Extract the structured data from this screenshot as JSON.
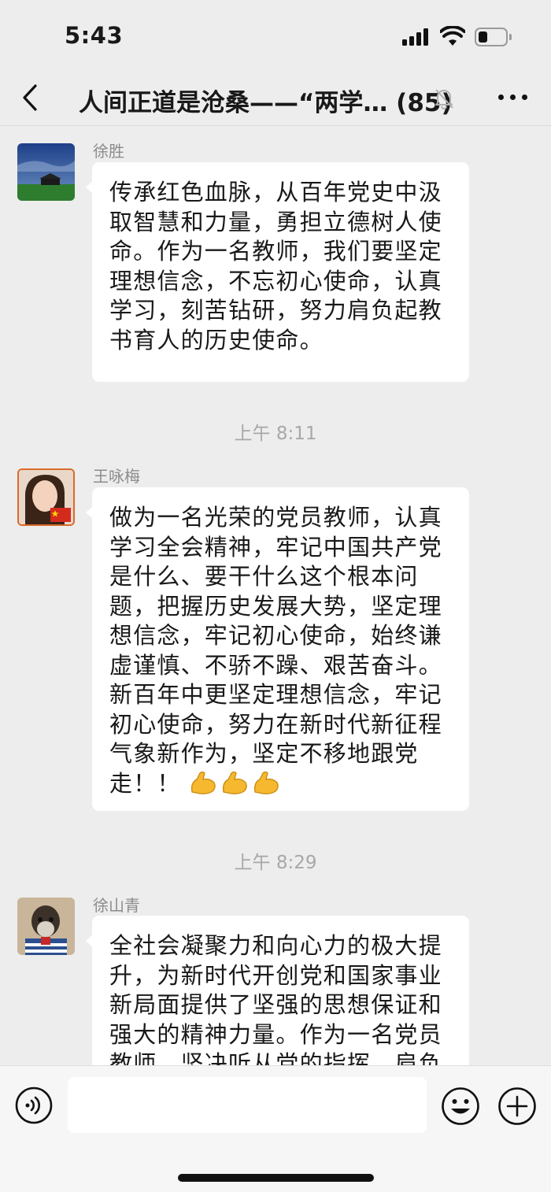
{
  "status_bar": {
    "time": "5:43",
    "battery_level": 0.35
  },
  "header": {
    "title": "人间正道是沧桑——“两学… (85)",
    "member_count": "85",
    "muted": true
  },
  "messages": [
    {
      "sender": "徐胜",
      "avatar_icon": "landscape-avatar-icon",
      "text": "传承红色血脉，从百年党史中汲\n取智慧和力量，勇担立德树人使\n命。作为一名教师，我们要坚定\n理想信念，不忘初心使命，认真\n学习，刻苦钻研，努力肩负起教\n书育人的历史使命。"
    },
    {
      "timestamp": "上午 8:11",
      "sender": "王咏梅",
      "avatar_icon": "portrait-with-flag-avatar-icon",
      "text": "做为一名光荣的党员教师，认真\n学习全会精神，牢记中国共产党\n是什么、要干什么这个根本问\n题，把握历史发展大势，坚定理\n想信念，牢记初心使命，始终谦\n虚谨慎、不骄不躁、艰苦奋斗。\n新百年中更坚定理想信念，牢记\n初心使命，努力在新时代新征程\n气象新作为，坚定不移地跟党\n走！！",
      "emojis": [
        "flexed-biceps-icon",
        "flexed-biceps-icon",
        "flexed-biceps-icon"
      ]
    },
    {
      "timestamp": "上午 8:29",
      "sender": "徐山青",
      "avatar_icon": "dog-avatar-icon",
      "text": "全社会凝聚力和向心力的极大提\n升，为新时代开创党和国家事业\n新局面提供了坚强的思想保证和\n强大的精神力量。作为一名党员\n教师，坚决听从党的指挥，肩负"
    }
  ],
  "input_bar": {
    "placeholder": ""
  },
  "colors": {
    "background": "#ededed",
    "bubble": "#ffffff",
    "meta_text": "#8c8c8c",
    "timestamp": "#a8a8a8"
  }
}
